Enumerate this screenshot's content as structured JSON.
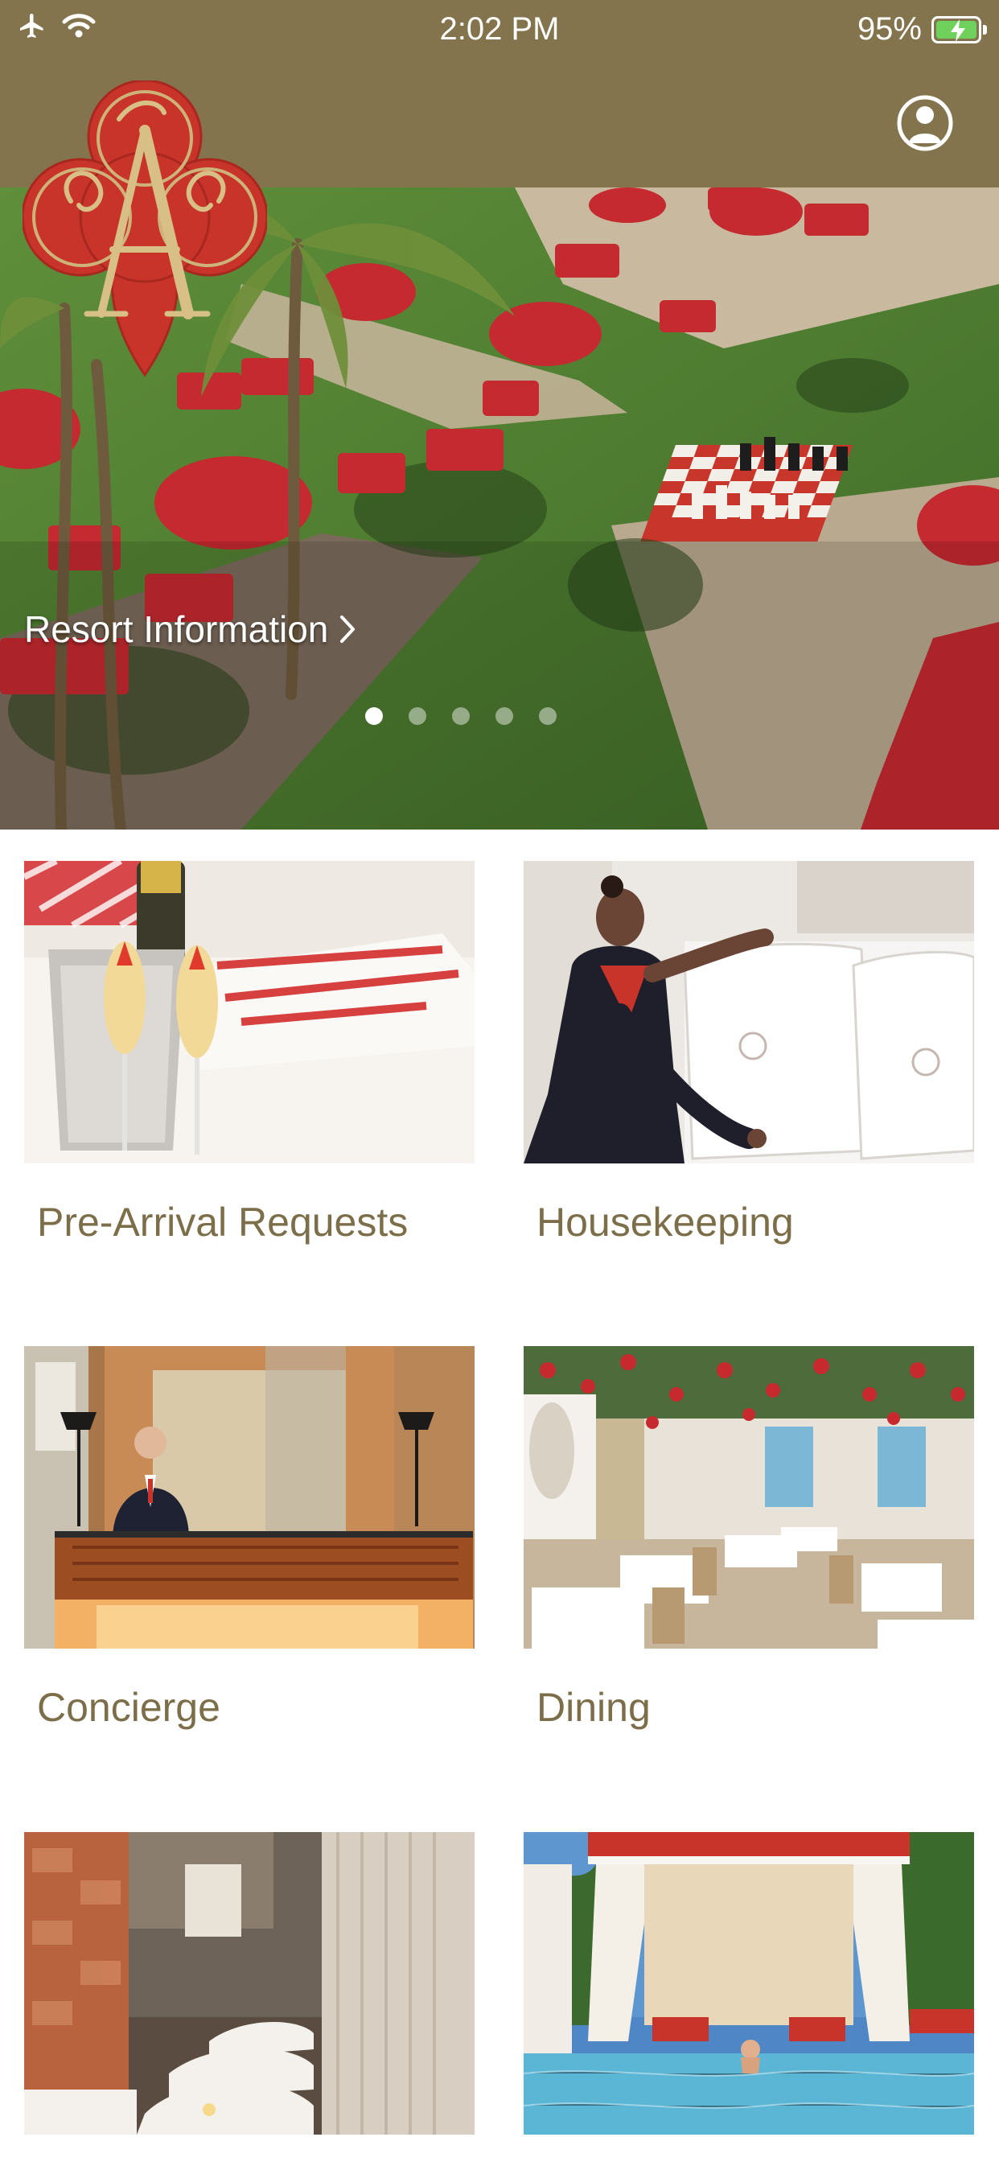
{
  "status_bar": {
    "time": "2:02 PM",
    "battery": "95%"
  },
  "header": {
    "profile_icon": "user-circle-icon",
    "logo_icon": "resort-crest-logo",
    "background_color": "#84744d"
  },
  "hero": {
    "link_label": "Resort Information",
    "link_icon": "chevron-right-icon",
    "carousel": {
      "total_pages": 5,
      "current_page": 1
    }
  },
  "tiles": [
    {
      "label": "Pre-Arrival Requests",
      "image": "champagne-and-bed-photo"
    },
    {
      "label": "Housekeeping",
      "image": "housekeeper-making-bed-photo"
    },
    {
      "label": "Concierge",
      "image": "concierge-desk-photo"
    },
    {
      "label": "Dining",
      "image": "dining-room-photo"
    },
    {
      "label": "",
      "image": "spa-lounge-photo"
    },
    {
      "label": "",
      "image": "pool-cabana-photo"
    }
  ],
  "colors": {
    "accent": "#84744d",
    "label_text": "#7d6e4a",
    "logo_red": "#c8342a"
  }
}
